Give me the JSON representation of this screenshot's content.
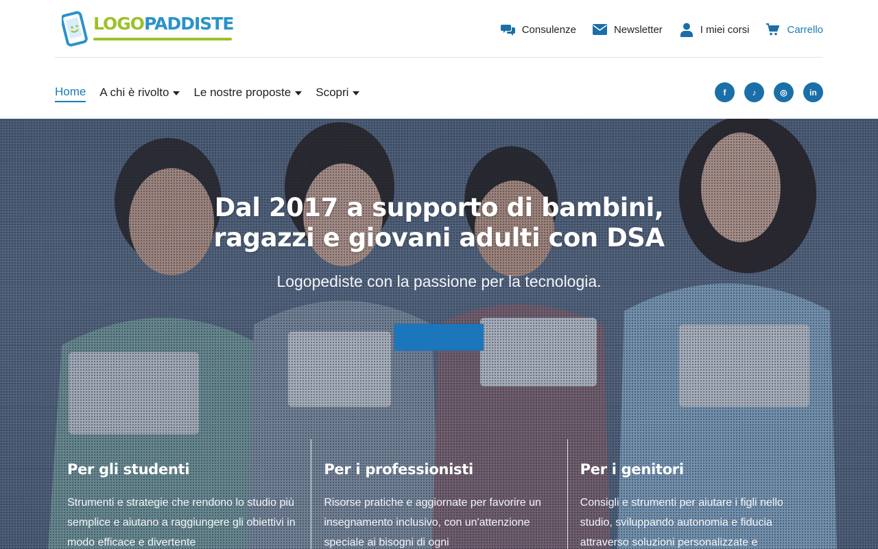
{
  "header": {
    "logo": {
      "part1": "LOGO",
      "part2": "PADDISTE"
    },
    "utility_links": [
      {
        "label": "Consulenze",
        "icon": "chat-bubbles-icon"
      },
      {
        "label": "Newsletter",
        "icon": "envelope-icon"
      },
      {
        "label": "I miei corsi",
        "icon": "user-icon"
      },
      {
        "label": "Carrello",
        "icon": "cart-icon"
      }
    ]
  },
  "nav": {
    "items": [
      {
        "label": "Home",
        "active": true
      },
      {
        "label": "A chi è rivolto",
        "dropdown": true
      },
      {
        "label": "Le nostre proposte",
        "dropdown": true
      },
      {
        "label": "Scopri",
        "dropdown": true
      }
    ],
    "social": [
      {
        "name": "facebook-icon",
        "glyph": "f"
      },
      {
        "name": "tiktok-icon",
        "glyph": "♪"
      },
      {
        "name": "instagram-icon",
        "glyph": "◎"
      },
      {
        "name": "linkedin-icon",
        "glyph": "in"
      }
    ]
  },
  "hero": {
    "title_line1": "Dal 2017 a supporto di bambini,",
    "title_line2": "ragazzi e giovani adulti con DSA",
    "subtitle": "Logopediste con la passione per la tecnologia.",
    "cta_label": ""
  },
  "columns": [
    {
      "title": "Per gli studenti",
      "text": "Strumenti e strategie che rendono lo studio più semplice e aiutano a raggiungere gli obiettivi in modo efficace e divertente"
    },
    {
      "title": "Per i professionisti",
      "text": "Risorse pratiche e aggiornate per favorire un insegnamento inclusivo, con un'attenzione speciale ai bisogni di ogni"
    },
    {
      "title": "Per i genitori",
      "text": "Consigli e strumenti per aiutare i figli nello studio, sviluppando autonomia e fiducia attraverso soluzioni personalizzate e"
    }
  ],
  "colors": {
    "accent": "#1a7ab8",
    "logo_green": "#9cc128",
    "logo_blue": "#2a93c9",
    "social_bg": "#1a6fa8",
    "cta": "#1b76bb"
  }
}
